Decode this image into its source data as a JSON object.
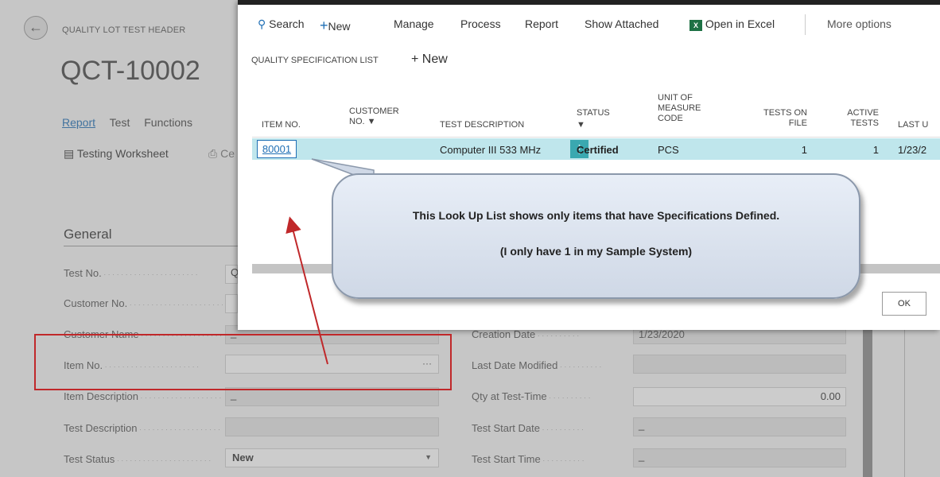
{
  "header": {
    "caption": "QUALITY LOT TEST HEADER",
    "title": "QCT-10002",
    "actions": [
      "Report",
      "Test",
      "Functions"
    ],
    "testing_worksheet": "Testing Worksheet",
    "ce_fragment": "Ce"
  },
  "general": {
    "title": "General",
    "fields": [
      {
        "label": "Test No.",
        "value": "Q"
      },
      {
        "label": "Customer No.",
        "value": ""
      },
      {
        "label": "Customer Name",
        "value": "_"
      },
      {
        "label": "Item No.",
        "value": "···"
      },
      {
        "label": "Item Description",
        "value": "_"
      },
      {
        "label": "Test Description",
        "value": ""
      },
      {
        "label": "Test Status",
        "value": "New"
      }
    ],
    "right_fields": [
      {
        "label": "Creation Date",
        "value": "1/23/2020"
      },
      {
        "label": "Last Date Modified",
        "value": ""
      },
      {
        "label": "Qty at Test-Time",
        "value": "0.00"
      },
      {
        "label": "Test Start Date",
        "value": "_"
      },
      {
        "label": "Test Start Time",
        "value": "_"
      }
    ]
  },
  "modal": {
    "toolbar": {
      "search": "Search",
      "new": "New",
      "manage": "Manage",
      "process": "Process",
      "report": "Report",
      "show_attached": "Show Attached",
      "open_excel": "Open in Excel",
      "more_options": "More options"
    },
    "title": "QUALITY SPECIFICATION LIST",
    "new_label": "New",
    "columns": {
      "item_no": "ITEM NO.",
      "customer_1": "CUSTOMER",
      "customer_2": "NO.",
      "test_description": "TEST DESCRIPTION",
      "status_1": "STATUS",
      "uom_1": "UNIT OF",
      "uom_2": "MEASURE",
      "uom_3": "CODE",
      "tests_on_1": "TESTS ON",
      "tests_on_2": "FILE",
      "active_1": "ACTIVE",
      "active_2": "TESTS",
      "last": "LAST U"
    },
    "row": {
      "item_no": "80001",
      "test_description": "Computer III 533 MHz",
      "status": "Certified",
      "uom": "PCS",
      "tests_on_file": "1",
      "active_tests": "1",
      "last": "1/23/2"
    },
    "ok_label": "OK"
  },
  "callout": {
    "line1": "This Look Up List shows only items that have Specifications Defined.",
    "line2": "(I only have 1 in my Sample System)"
  },
  "colors": {
    "accent": "#1f6fb5",
    "row_highlight": "#bfe6ec",
    "annotation_red": "#c0282a"
  }
}
